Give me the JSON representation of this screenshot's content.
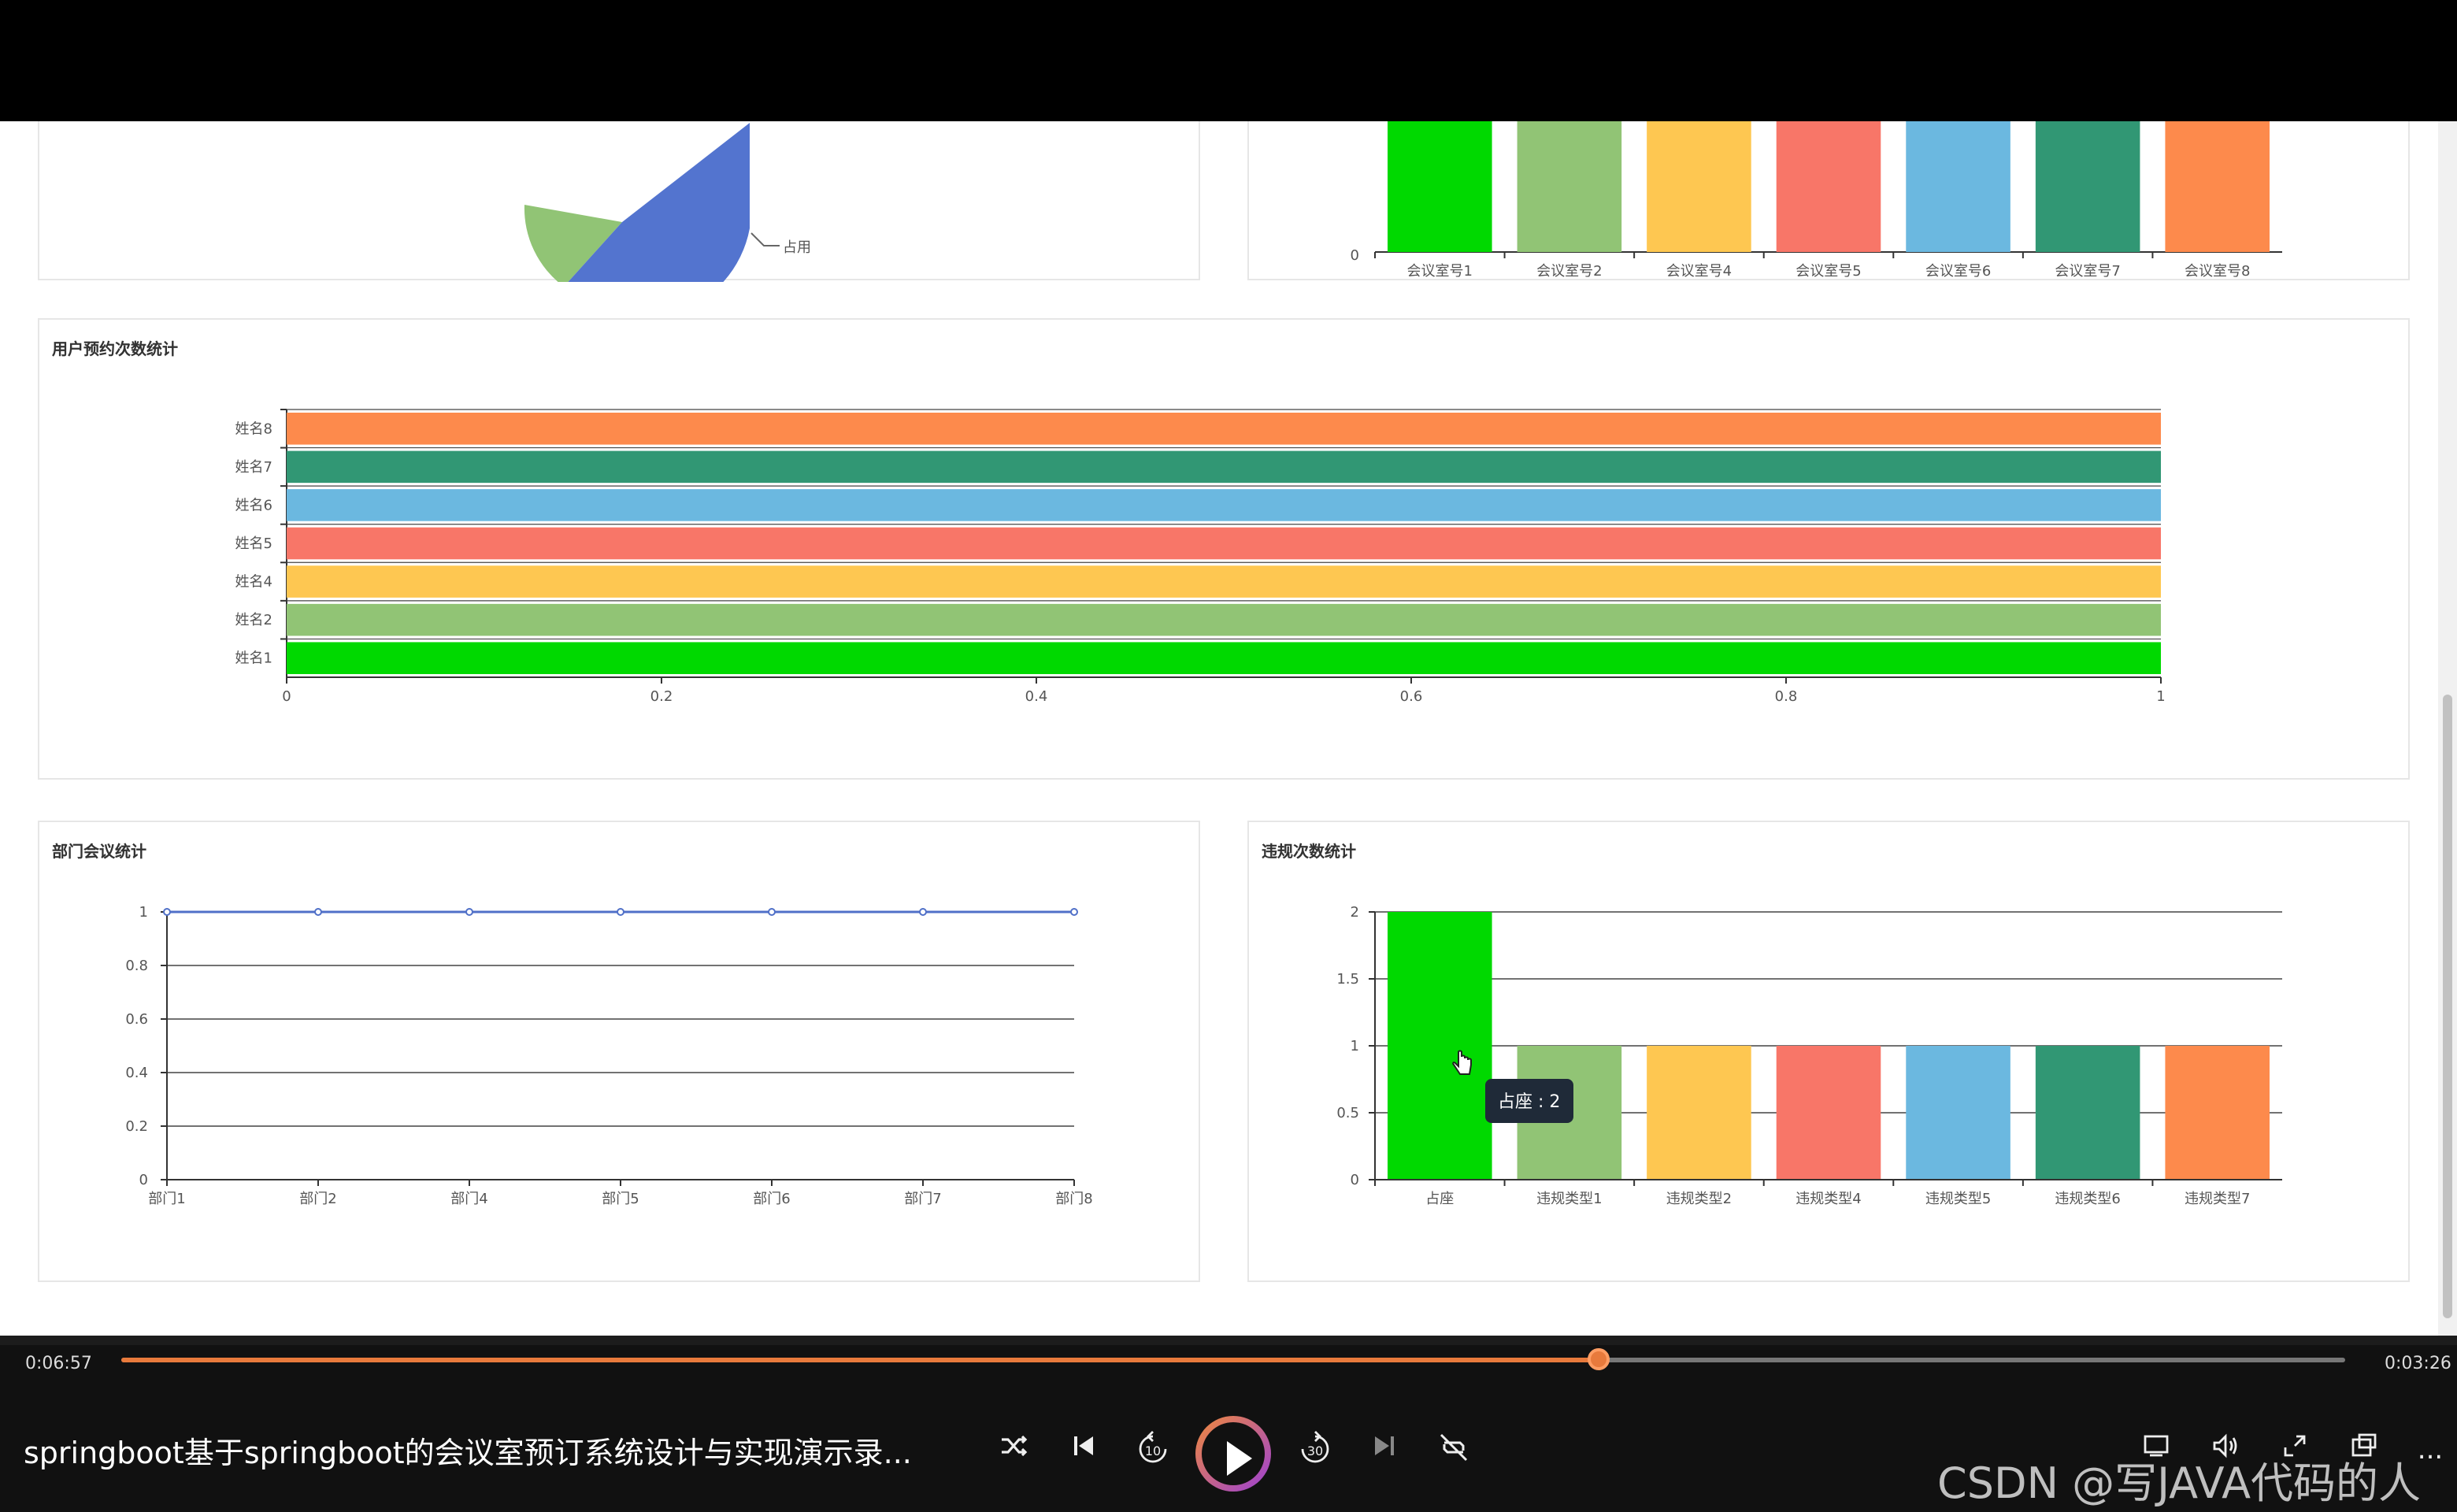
{
  "charts": {
    "room_pie": {
      "labels": [
        "占用"
      ]
    },
    "room_bar": {
      "categories": [
        "会议室号1",
        "会议室号2",
        "会议室号4",
        "会议室号5",
        "会议室号6",
        "会议室号7",
        "会议室号8"
      ],
      "y_tick": "0"
    },
    "user_stats": {
      "title": "用户预约次数统计",
      "categories": [
        "姓名1",
        "姓名2",
        "姓名4",
        "姓名5",
        "姓名6",
        "姓名7",
        "姓名8"
      ],
      "values": [
        1,
        1,
        1,
        1,
        1,
        1,
        1
      ],
      "x_ticks": [
        "0",
        "0.2",
        "0.4",
        "0.6",
        "0.8",
        "1"
      ]
    },
    "dept_stats": {
      "title": "部门会议统计",
      "categories": [
        "部门1",
        "部门2",
        "部门4",
        "部门5",
        "部门6",
        "部门7",
        "部门8"
      ],
      "values": [
        1,
        1,
        1,
        1,
        1,
        1,
        1
      ],
      "y_ticks": [
        "0",
        "0.2",
        "0.4",
        "0.6",
        "0.8",
        "1"
      ]
    },
    "violation_stats": {
      "title": "违规次数统计",
      "categories": [
        "占座",
        "违规类型1",
        "违规类型2",
        "违规类型4",
        "违规类型5",
        "违规类型6",
        "违规类型7"
      ],
      "values": [
        2,
        1,
        1,
        1,
        1,
        1,
        1
      ],
      "y_ticks": [
        "0",
        "0.5",
        "1",
        "1.5",
        "2"
      ],
      "tooltip": "占座 : 2"
    }
  },
  "chart_data": [
    {
      "type": "pie",
      "labels": [
        "占用"
      ]
    },
    {
      "type": "bar",
      "categories": [
        "会议室号1",
        "会议室号2",
        "会议室号4",
        "会议室号5",
        "会议室号6",
        "会议室号7",
        "会议室号8"
      ]
    },
    {
      "type": "bar",
      "orientation": "horizontal",
      "title": "用户预约次数统计",
      "categories": [
        "姓名1",
        "姓名2",
        "姓名4",
        "姓名5",
        "姓名6",
        "姓名7",
        "姓名8"
      ],
      "values": [
        1,
        1,
        1,
        1,
        1,
        1,
        1
      ],
      "xlim": [
        0,
        1
      ]
    },
    {
      "type": "line",
      "title": "部门会议统计",
      "categories": [
        "部门1",
        "部门2",
        "部门4",
        "部门5",
        "部门6",
        "部门7",
        "部门8"
      ],
      "values": [
        1,
        1,
        1,
        1,
        1,
        1,
        1
      ],
      "ylim": [
        0,
        1
      ]
    },
    {
      "type": "bar",
      "title": "违规次数统计",
      "categories": [
        "占座",
        "违规类型1",
        "违规类型2",
        "违规类型4",
        "违规类型5",
        "违规类型6",
        "违规类型7"
      ],
      "values": [
        2,
        1,
        1,
        1,
        1,
        1,
        1
      ],
      "ylim": [
        0,
        2
      ]
    }
  ],
  "colors": {
    "palette": [
      "#00d900",
      "#91c475",
      "#fec751",
      "#f87668",
      "#6bb8e0",
      "#319774",
      "#fd8a4c"
    ],
    "pie_blue": "#5374cf",
    "line_blue": "#5070c8",
    "accent": "#e87a3c"
  },
  "player": {
    "current_time": "0:06:57",
    "duration": "0:03:26",
    "progress": 0.664,
    "title": "springboot基于springboot的会议室预订系统设计与实现演示录...",
    "controls": [
      "shuffle-icon",
      "prev-icon",
      "rewind-10-icon",
      "play-icon",
      "forward-30-icon",
      "next-icon",
      "loop-off-icon",
      "subtitle-icon",
      "volume-icon",
      "fullscreen-icon",
      "pip-icon",
      "more-icon"
    ],
    "rewind_label": "10",
    "forward_label": "30",
    "watermark": "CSDN @写JAVA代码的人",
    "more_label": "..."
  }
}
